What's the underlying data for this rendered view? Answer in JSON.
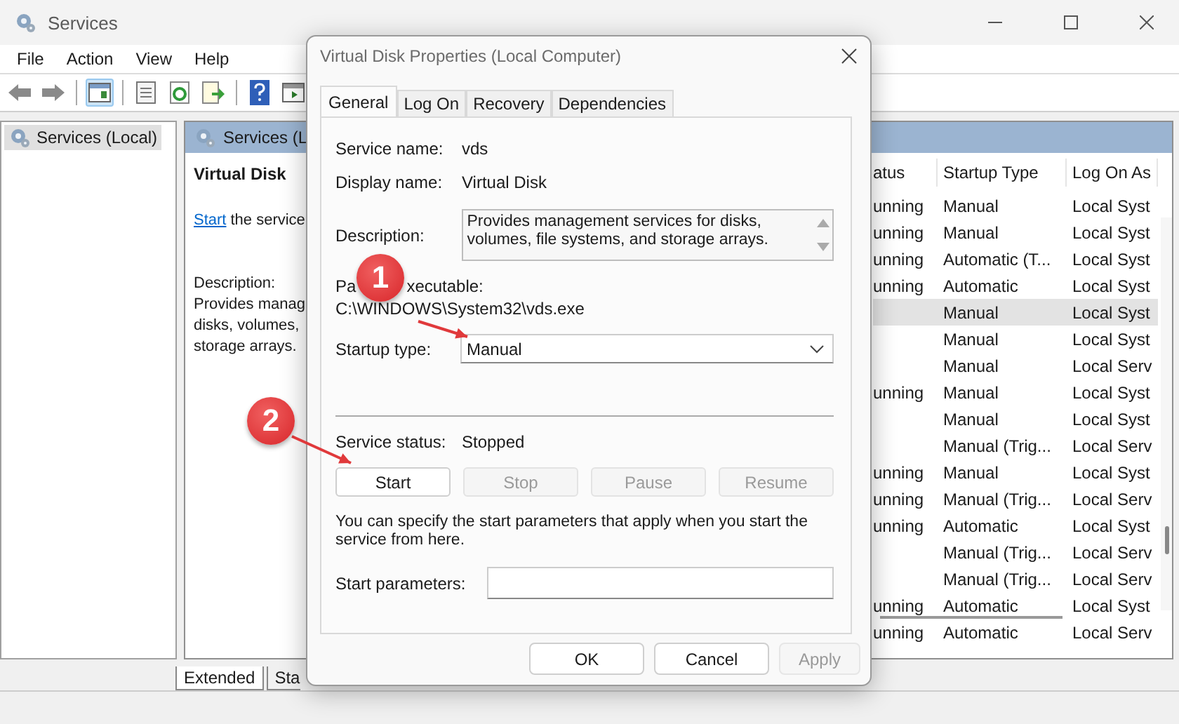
{
  "window": {
    "title": "Services"
  },
  "menu": [
    "File",
    "Action",
    "View",
    "Help"
  ],
  "tree": [
    {
      "label": "Services (Local)",
      "selected": true
    }
  ],
  "pane": {
    "header": "Services (L",
    "service_title": "Virtual Disk",
    "start_link": "Start",
    "start_rest": "the service",
    "description_label": "Description:",
    "description_lines": [
      "Provides manag",
      "disks, volumes,",
      "storage arrays."
    ]
  },
  "table": {
    "columns": [
      "atus",
      "Startup Type",
      "Log On As"
    ],
    "rows": [
      {
        "status": "unning",
        "startup": "Manual",
        "logon": "Local Syst",
        "selected": false
      },
      {
        "status": "unning",
        "startup": "Manual",
        "logon": "Local Syst",
        "selected": false
      },
      {
        "status": "unning",
        "startup": "Automatic (T...",
        "logon": "Local Syst",
        "selected": false
      },
      {
        "status": "unning",
        "startup": "Automatic",
        "logon": "Local Syst",
        "selected": false
      },
      {
        "status": "",
        "startup": "Manual",
        "logon": "Local Syst",
        "selected": true
      },
      {
        "status": "",
        "startup": "Manual",
        "logon": "Local Syst",
        "selected": false
      },
      {
        "status": "",
        "startup": "Manual",
        "logon": "Local Serv",
        "selected": false
      },
      {
        "status": "unning",
        "startup": "Manual",
        "logon": "Local Syst",
        "selected": false
      },
      {
        "status": "",
        "startup": "Manual",
        "logon": "Local Syst",
        "selected": false
      },
      {
        "status": "",
        "startup": "Manual (Trig...",
        "logon": "Local Serv",
        "selected": false
      },
      {
        "status": "unning",
        "startup": "Manual",
        "logon": "Local Syst",
        "selected": false
      },
      {
        "status": "unning",
        "startup": "Manual (Trig...",
        "logon": "Local Serv",
        "selected": false
      },
      {
        "status": "unning",
        "startup": "Automatic",
        "logon": "Local Syst",
        "selected": false
      },
      {
        "status": "",
        "startup": "Manual (Trig...",
        "logon": "Local Serv",
        "selected": false
      },
      {
        "status": "",
        "startup": "Manual (Trig...",
        "logon": "Local Serv",
        "selected": false
      },
      {
        "status": "unning",
        "startup": "Automatic",
        "logon": "Local Syst",
        "selected": false
      },
      {
        "status": "unning",
        "startup": "Automatic",
        "logon": "Local Serv",
        "selected": false
      }
    ]
  },
  "bottom_tabs": [
    {
      "label": "Extended",
      "selected": true
    },
    {
      "label": "Sta",
      "selected": false
    }
  ],
  "dialog": {
    "title": "Virtual Disk Properties (Local Computer)",
    "tabs": [
      {
        "label": "General",
        "selected": true
      },
      {
        "label": "Log On",
        "selected": false
      },
      {
        "label": "Recovery",
        "selected": false
      },
      {
        "label": "Dependencies",
        "selected": false
      }
    ],
    "service_name_label": "Service name:",
    "service_name": "vds",
    "display_name_label": "Display name:",
    "display_name": "Virtual Disk",
    "description_label": "Description:",
    "description": "Provides management services for disks, volumes, file systems, and storage arrays.",
    "path_label_parts": [
      "Pa",
      "xecutable:"
    ],
    "path": "C:\\WINDOWS\\System32\\vds.exe",
    "startup_label": "Startup type:",
    "startup_value": "Manual",
    "status_label": "Service status:",
    "status": "Stopped",
    "service_buttons": [
      {
        "label": "Start",
        "disabled": false
      },
      {
        "label": "Stop",
        "disabled": true
      },
      {
        "label": "Pause",
        "disabled": true
      },
      {
        "label": "Resume",
        "disabled": true
      }
    ],
    "hint": "You can specify the start parameters that apply when you start the service from here.",
    "params_label": "Start parameters:",
    "buttons": [
      {
        "label": "OK",
        "disabled": false
      },
      {
        "label": "Cancel",
        "disabled": false
      },
      {
        "label": "Apply",
        "disabled": true
      }
    ]
  },
  "annotations": [
    {
      "label": "1"
    },
    {
      "label": "2"
    }
  ]
}
